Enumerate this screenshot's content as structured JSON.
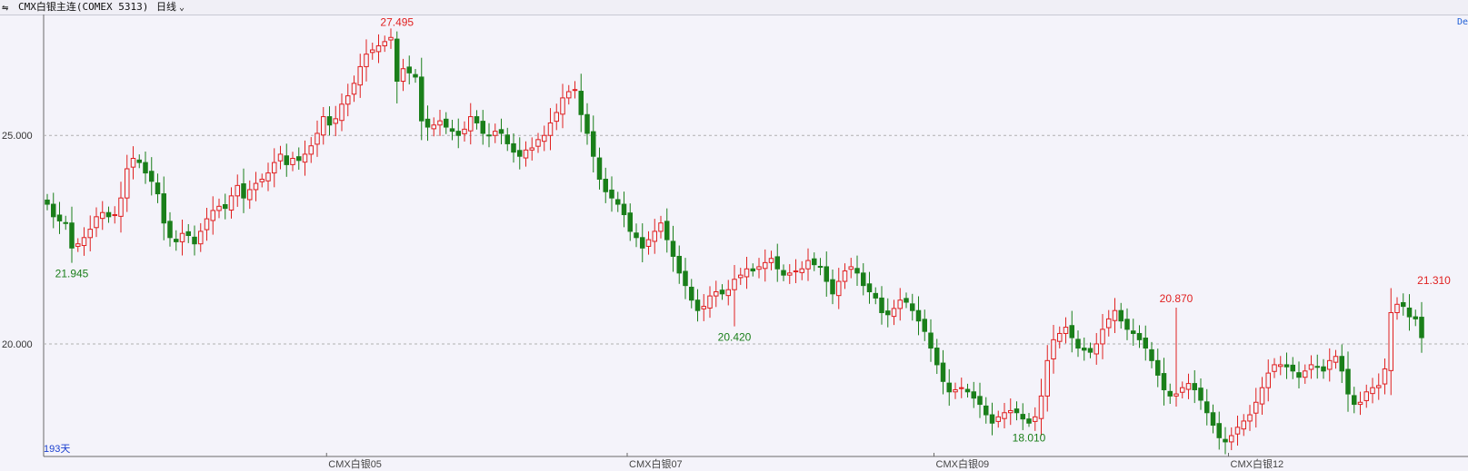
{
  "header": {
    "title": "CMX白银主连(COMEX 5313)",
    "period": "日线"
  },
  "corner_tag": "De",
  "days_label": "193天",
  "colors": {
    "up": "#e02020",
    "down": "#1a7f1a",
    "grid": "#b0b0b0",
    "background": "#f4f3fa"
  },
  "chart_data": {
    "type": "candlestick",
    "y_ticks": [
      "25.000",
      "20.000"
    ],
    "ylim": [
      17.3,
      27.9
    ],
    "month_labels": [
      {
        "label": "CMX白银05",
        "index": 47
      },
      {
        "label": "CMX白银07",
        "index": 96
      },
      {
        "label": "CMX白银09",
        "index": 146
      },
      {
        "label": "CMX白银12",
        "index": 194
      }
    ],
    "annotations": [
      {
        "text": "27.495",
        "index": 57,
        "value": 27.495,
        "kind": "high"
      },
      {
        "text": "21.945",
        "index": 4,
        "value": 21.945,
        "kind": "low"
      },
      {
        "text": "20.420",
        "index": 112,
        "value": 20.42,
        "kind": "low"
      },
      {
        "text": "18.010",
        "index": 160,
        "value": 18.01,
        "kind": "low"
      },
      {
        "text": "20.870",
        "index": 184,
        "value": 20.87,
        "kind": "high"
      },
      {
        "text": "21.310",
        "index": 226,
        "value": 21.31,
        "kind": "high"
      }
    ],
    "closes": [
      23.35,
      23.05,
      22.95,
      22.9,
      22.3,
      22.4,
      22.55,
      22.75,
      23.05,
      23.15,
      23.05,
      23.1,
      23.5,
      24.2,
      24.45,
      24.35,
      24.1,
      23.9,
      23.6,
      22.9,
      22.55,
      22.45,
      22.65,
      22.6,
      22.4,
      22.7,
      23.0,
      23.2,
      23.3,
      23.25,
      23.55,
      23.8,
      23.5,
      23.7,
      23.85,
      23.95,
      24.1,
      24.35,
      24.55,
      24.3,
      24.45,
      24.4,
      24.55,
      24.75,
      25.05,
      25.45,
      25.25,
      25.4,
      25.75,
      25.95,
      26.25,
      26.65,
      26.95,
      27.05,
      27.15,
      27.25,
      27.35,
      26.3,
      26.6,
      26.5,
      26.4,
      25.35,
      25.2,
      25.25,
      25.35,
      25.2,
      25.1,
      25.0,
      25.15,
      25.45,
      25.3,
      25.05,
      25.0,
      25.1,
      25.05,
      24.8,
      24.6,
      24.5,
      24.65,
      24.7,
      24.9,
      25.0,
      25.3,
      25.55,
      25.9,
      26.05,
      26.1,
      25.5,
      25.05,
      24.5,
      23.95,
      23.65,
      23.5,
      23.35,
      23.1,
      22.7,
      22.55,
      22.3,
      22.5,
      22.7,
      22.9,
      22.5,
      22.1,
      21.7,
      21.4,
      21.05,
      20.8,
      20.9,
      21.15,
      21.25,
      21.2,
      21.3,
      21.55,
      21.65,
      21.8,
      21.75,
      21.85,
      21.95,
      22.05,
      21.8,
      21.65,
      21.7,
      21.75,
      21.8,
      22.0,
      21.9,
      21.85,
      21.5,
      21.2,
      21.5,
      21.75,
      21.85,
      21.7,
      21.4,
      21.25,
      21.1,
      20.75,
      20.7,
      20.85,
      21.05,
      21.0,
      20.8,
      20.55,
      20.3,
      19.9,
      19.5,
      19.1,
      18.85,
      18.9,
      18.95,
      18.85,
      18.7,
      18.55,
      18.3,
      18.1,
      18.25,
      18.35,
      18.4,
      18.35,
      18.2,
      18.1,
      18.25,
      18.75,
      19.6,
      20.1,
      20.25,
      20.4,
      20.15,
      19.9,
      19.85,
      19.8,
      20.0,
      20.35,
      20.6,
      20.8,
      20.55,
      20.35,
      20.25,
      20.1,
      19.9,
      19.6,
      19.25,
      18.9,
      18.75,
      18.8,
      18.95,
      19.05,
      18.9,
      18.65,
      18.35,
      18.05,
      17.75,
      17.65,
      17.8,
      18.0,
      18.15,
      18.3,
      18.6,
      18.95,
      19.3,
      19.5,
      19.5,
      19.45,
      19.35,
      19.2,
      19.35,
      19.5,
      19.45,
      19.35,
      19.6,
      19.7,
      19.35,
      18.8,
      18.55,
      18.6,
      18.85,
      18.95,
      19.0,
      19.4,
      20.75,
      20.95,
      20.9,
      20.65,
      20.6,
      20.15
    ]
  }
}
